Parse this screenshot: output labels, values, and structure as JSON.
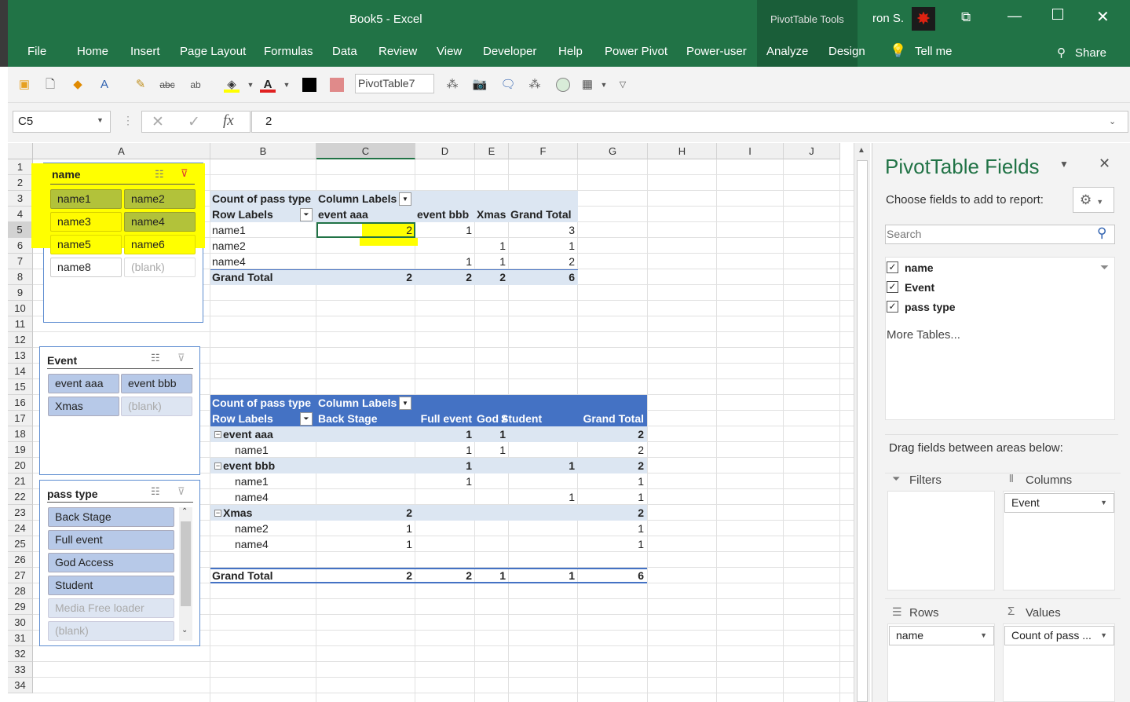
{
  "window": {
    "title": "Book5 - Excel",
    "context_label": "PivotTable Tools",
    "user": "ron S."
  },
  "tabs": [
    "File",
    "Home",
    "Insert",
    "Page Layout",
    "Formulas",
    "Data",
    "Review",
    "View",
    "Developer",
    "Help",
    "Power Pivot",
    "Power-user",
    "Analyze",
    "Design"
  ],
  "tell_me": "Tell me",
  "share": "Share",
  "toolbar": {
    "pivot_name": "PivotTable7"
  },
  "formula_bar": {
    "name_box": "C5",
    "formula": "2"
  },
  "columns": [
    "A",
    "B",
    "C",
    "D",
    "E",
    "F",
    "G",
    "H",
    "I",
    "J"
  ],
  "rows": [
    "1",
    "2",
    "3",
    "4",
    "5",
    "6",
    "7",
    "8",
    "9",
    "10",
    "11",
    "12",
    "13",
    "14",
    "15",
    "16",
    "17",
    "18",
    "19",
    "20",
    "21",
    "22",
    "23",
    "24",
    "25",
    "26",
    "27",
    "28",
    "29",
    "30",
    "31",
    "32",
    "33",
    "34"
  ],
  "slicer_name": {
    "title": "name",
    "items": [
      "name1",
      "name2",
      "name3",
      "name4",
      "name5",
      "name6",
      "name8",
      "(blank)"
    ]
  },
  "slicer_event": {
    "title": "Event",
    "items": [
      "event aaa",
      "event bbb",
      "Xmas",
      "(blank)"
    ]
  },
  "slicer_pass": {
    "title": "pass type",
    "items": [
      "Back Stage",
      "Full event",
      "God Access",
      "Student",
      "Media Free loader",
      "(blank)"
    ]
  },
  "pivot1": {
    "values_label": "Count of pass type",
    "col_labels": "Column Labels",
    "row_labels": "Row Labels",
    "headers": [
      "event aaa",
      "event bbb",
      "Xmas",
      "Grand Total"
    ],
    "rows": [
      {
        "label": "name1",
        "vals": [
          "2",
          "1",
          "",
          "3"
        ]
      },
      {
        "label": "name2",
        "vals": [
          "",
          "",
          "1",
          "1"
        ]
      },
      {
        "label": "name4",
        "vals": [
          "",
          "1",
          "1",
          "2"
        ]
      }
    ],
    "total": {
      "label": "Grand Total",
      "vals": [
        "2",
        "2",
        "2",
        "6"
      ]
    }
  },
  "pivot2": {
    "values_label": "Count of pass type",
    "col_labels": "Column Labels",
    "row_labels": "Row Labels",
    "headers": [
      "Back Stage",
      "Full event",
      "God A",
      "Student",
      "Grand Total"
    ],
    "rows": [
      {
        "label": "event aaa",
        "group": true,
        "vals": [
          "",
          "1",
          "1",
          "",
          "2"
        ]
      },
      {
        "label": "name1",
        "group": false,
        "vals": [
          "",
          "1",
          "1",
          "",
          "2"
        ]
      },
      {
        "label": "event bbb",
        "group": true,
        "vals": [
          "",
          "1",
          "",
          "1",
          "2"
        ]
      },
      {
        "label": "name1",
        "group": false,
        "vals": [
          "",
          "1",
          "",
          "",
          "1"
        ]
      },
      {
        "label": "name4",
        "group": false,
        "vals": [
          "",
          "",
          "",
          "1",
          "1"
        ]
      },
      {
        "label": "Xmas",
        "group": true,
        "vals": [
          "2",
          "",
          "",
          "",
          "2"
        ]
      },
      {
        "label": "name2",
        "group": false,
        "vals": [
          "1",
          "",
          "",
          "",
          "1"
        ]
      },
      {
        "label": "name4",
        "group": false,
        "vals": [
          "1",
          "",
          "",
          "",
          "1"
        ]
      }
    ],
    "total": {
      "label": "Grand Total",
      "vals": [
        "2",
        "2",
        "1",
        "1",
        "6"
      ]
    }
  },
  "fields_panel": {
    "title": "PivotTable Fields",
    "choose": "Choose fields to add to report:",
    "search_placeholder": "Search",
    "fields": [
      "name",
      "Event",
      "pass type"
    ],
    "more_tables": "More Tables...",
    "drag_label": "Drag fields between areas below:",
    "filters": "Filters",
    "columns": "Columns",
    "rows": "Rows",
    "values": "Values",
    "columns_field": "Event",
    "rows_field": "name",
    "values_field": "Count of pass ..."
  },
  "colors": {
    "excel_green": "#217346",
    "pivot_header": "#dce6f2",
    "pivot_blue": "#4472c4",
    "slicer_selected": "#b2c23a",
    "highlight": "#ffff00"
  }
}
